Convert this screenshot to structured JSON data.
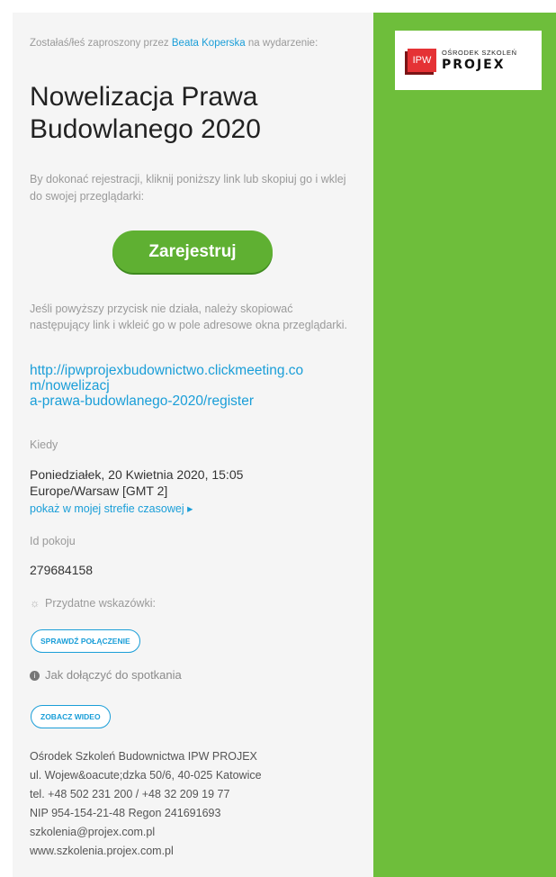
{
  "invite": {
    "prefix": "Zostałaś/łeś zaproszony przez ",
    "host": "Beata Koperska",
    "suffix": " na wydarzenie:"
  },
  "event": {
    "title": "Nowelizacja Prawa Budowlanego 2020"
  },
  "instructions": "By dokonać rejestracji, kliknij poniższy link lub skopiuj go i wklej do swojej przeglądarki:",
  "register_button": "Zarejestruj",
  "fallback_text": "Jeśli powyższy przycisk nie działa, należy skopiować następujący link i wkleić go w pole adresowe okna przeglądarki.",
  "register_link_lines": [
    "http://ipwprojexbudownictwo.clickmeeting.co",
    "m/nowelizacj",
    "a-prawa-budowlanego-2020/register"
  ],
  "when": {
    "label": "Kiedy",
    "date": "Poniedziałek, 20 Kwietnia 2020, 15:05",
    "timezone": "Europe/Warsaw [GMT 2]",
    "tz_link": "pokaż w mojej strefie czasowej ▸"
  },
  "room": {
    "label": "Id pokoju",
    "id": "279684158"
  },
  "tips": {
    "label": "Przydatne wskazówki:",
    "check_button": "SPRAWDŹ POŁĄCZENIE",
    "join_help": "Jak dołączyć do spotkania",
    "video_button": "ZOBACZ WIDEO"
  },
  "footer": {
    "lines": [
      "Ośrodek Szkoleń Budownictwa IPW PROJEX",
      "ul. Wojew&oacute;dzka 50/6, 40-025 Katowice",
      "tel. +48 502 231 200 / +48 32 209 19 77",
      "NIP 954-154-21-48 Regon 241691693",
      "szkolenia@projex.com.pl",
      "www.szkolenia.projex.com.pl"
    ]
  },
  "logo": {
    "badge": "IPW",
    "top": "OŚRODEK SZKOLEŃ",
    "bottom": "PROJEX"
  },
  "colors": {
    "accent_green": "#6ebe3b",
    "link_blue": "#1a9ed8",
    "logo_red": "#e53235"
  }
}
